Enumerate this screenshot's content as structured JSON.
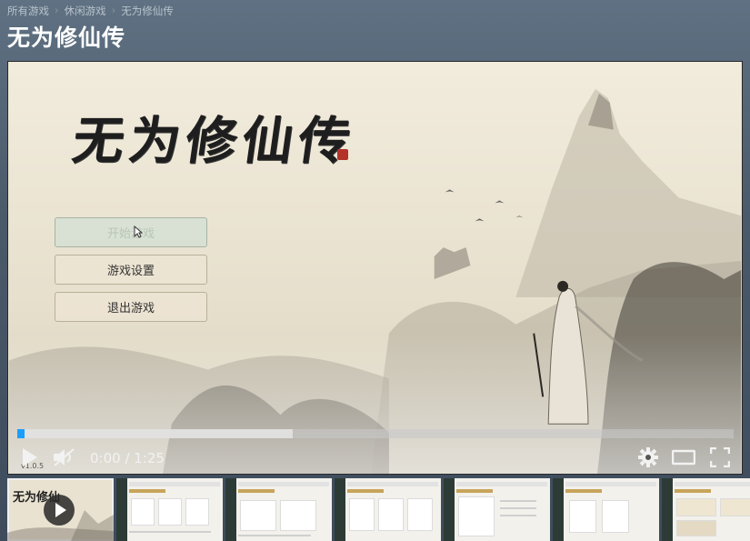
{
  "breadcrumb": [
    "所有游戏",
    "休闲游戏",
    "无为修仙传"
  ],
  "page_title": "无为修仙传",
  "game": {
    "logo_text": "无为修仙传",
    "menu": [
      {
        "label": "开始游戏",
        "active": true
      },
      {
        "label": "游戏设置",
        "active": false
      },
      {
        "label": "退出游戏",
        "active": false
      }
    ],
    "version": "v1.0.5"
  },
  "player": {
    "current_time": "0:00",
    "duration": "1:25",
    "time_display": "0:00 / 1:25",
    "progress": 0.01,
    "buffered": 0.385,
    "accent": "#1a9fff"
  },
  "thumbnails": {
    "count": 7,
    "selected_index": 0,
    "first_logo": "无为修仙"
  }
}
